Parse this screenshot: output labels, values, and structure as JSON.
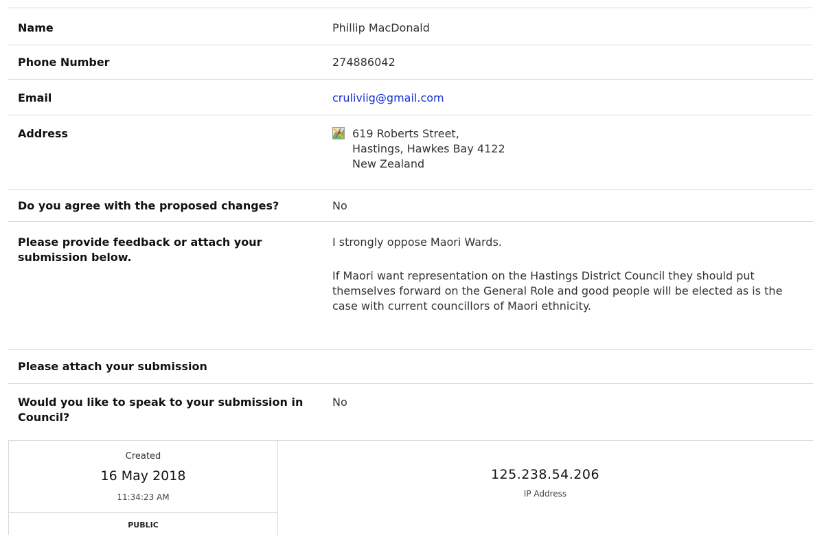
{
  "fields": {
    "name": {
      "label": "Name",
      "value": "Phillip  MacDonald"
    },
    "phone": {
      "label": "Phone Number",
      "value": "274886042"
    },
    "email": {
      "label": "Email",
      "value": "cruliviig@gmail.com"
    },
    "address": {
      "label": "Address",
      "icon": "map-icon",
      "line1": "619 Roberts Street,",
      "line2": "Hastings, Hawkes Bay 4122",
      "line3": "New Zealand"
    },
    "agree": {
      "label": "Do you agree with the proposed changes?",
      "value": "No"
    },
    "feedback": {
      "label": "Please provide feedback or attach your submission below.",
      "paragraph1": "I strongly oppose Maori Wards.",
      "paragraph2": "If Maori want representation on the Hastings District Council they should put themselves forward on the General Role and good people will be elected as is the case with current councillors of Maori ethnicity."
    },
    "attach": {
      "label": "Please attach your submission",
      "value": ""
    },
    "speak": {
      "label": "Would you like to speak to your submission in Council?",
      "value": "No"
    }
  },
  "meta": {
    "created_label": "Created",
    "created_date": "16 May 2018",
    "created_time": "11:34:23 AM",
    "visibility": "PUBLIC",
    "ip_address": "125.238.54.206",
    "ip_label": "IP Address"
  },
  "colors": {
    "link": "#1a31d1",
    "border": "#d9d9d9"
  }
}
